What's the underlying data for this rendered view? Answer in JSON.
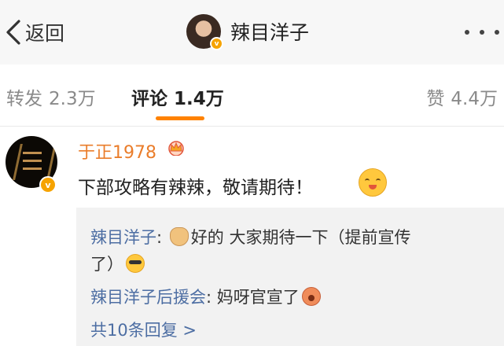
{
  "header": {
    "back_label": "返回",
    "profile_name": "辣目洋子"
  },
  "tabs": [
    {
      "label": "转发",
      "count": "2.3万"
    },
    {
      "label": "评论",
      "count": "1.4万"
    },
    {
      "label": "赞",
      "count": "4.4万"
    }
  ],
  "comment": {
    "author": "于正1978",
    "text": "下部攻略有辣辣，敬请期待！",
    "replies": [
      {
        "author": "辣目洋子",
        "text_a": "好的 大家期待一下（提前宣传",
        "text_b": "了）"
      },
      {
        "author": "辣目洋子后援会",
        "text": "妈呀官宣了"
      }
    ],
    "more_replies": "共10条回复 >"
  },
  "colors": {
    "accent_orange": "#ff8200",
    "vip_name": "#ea7d2b",
    "reply_name": "#4d6ea3",
    "verified_badge": "#f6a300"
  }
}
